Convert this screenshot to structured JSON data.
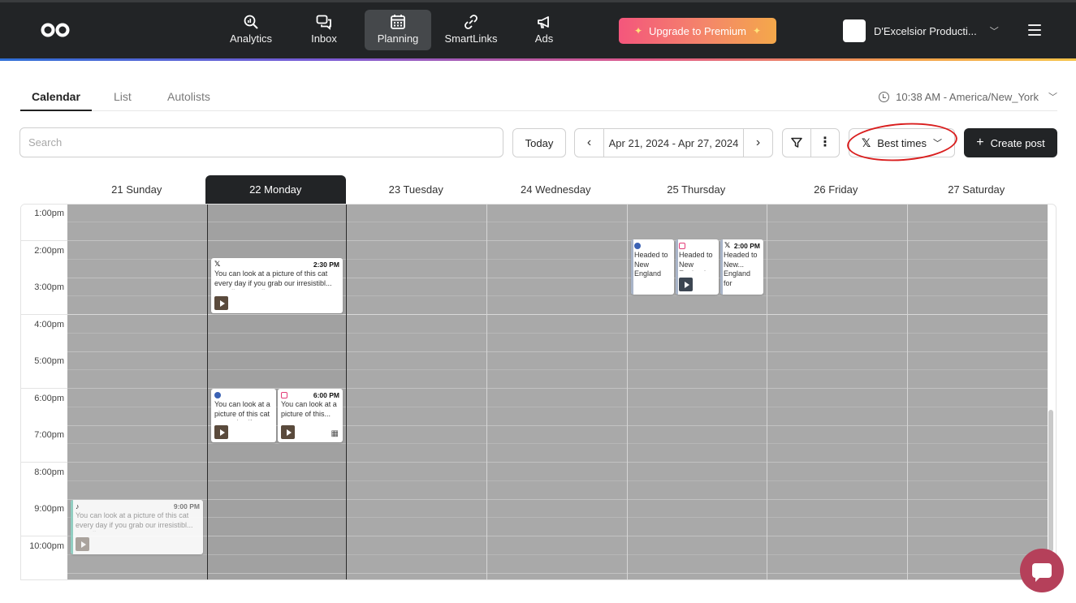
{
  "nav": {
    "items": [
      {
        "label": "Analytics",
        "icon": "analytics-icon"
      },
      {
        "label": "Inbox",
        "icon": "inbox-icon"
      },
      {
        "label": "Planning",
        "icon": "calendar-icon",
        "active": true
      },
      {
        "label": "SmartLinks",
        "icon": "link-icon"
      },
      {
        "label": "Ads",
        "icon": "megaphone-icon"
      }
    ],
    "upgrade_label": "Upgrade to Premium",
    "account_name": "D'Excelsior Producti..."
  },
  "tabs": [
    {
      "label": "Calendar",
      "active": true
    },
    {
      "label": "List"
    },
    {
      "label": "Autolists"
    }
  ],
  "timezone": "10:38 AM - America/New_York",
  "toolbar": {
    "search_placeholder": "Search",
    "today_label": "Today",
    "date_range": "Apr 21, 2024 - Apr 27, 2024",
    "best_times_label": "Best times",
    "create_post_label": "Create post"
  },
  "days": [
    {
      "label": "21 Sunday"
    },
    {
      "label": "22 Monday",
      "today": true
    },
    {
      "label": "23 Tuesday"
    },
    {
      "label": "24 Wednesday"
    },
    {
      "label": "25 Thursday"
    },
    {
      "label": "26 Friday"
    },
    {
      "label": "27 Saturday"
    }
  ],
  "time_labels": [
    "1:00pm",
    "2:00pm",
    "3:00pm",
    "4:00pm",
    "5:00pm",
    "6:00pm",
    "7:00pm",
    "8:00pm",
    "9:00pm",
    "10:00pm"
  ],
  "posts": {
    "mon_x": {
      "time": "2:30 PM",
      "text": "You can look at a picture of this cat every day if you grab our irresistibl... mug #catmug #cats",
      "network": "x"
    },
    "mon_fb": {
      "time": "",
      "text": "You can look at a picture of this cat every day if you grab our",
      "network": "facebook"
    },
    "mon_ig": {
      "time": "6:00 PM",
      "text": "You can look at a picture of this...",
      "network": "instagram"
    },
    "thu_fb": {
      "time": "",
      "text": "Headed to New England for Memorial Day Weekend",
      "network": "facebook"
    },
    "thu_ig": {
      "time": "",
      "text": "Headed to New England for Memorial Day Weekend",
      "network": "instagram"
    },
    "thu_x": {
      "time": "2:00 PM",
      "text": "Headed to New... England for",
      "network": "x"
    },
    "sun_tt": {
      "time": "9:00 PM",
      "text": "You can look at a picture of this cat every day if you grab our irresistibl... mug #catmug",
      "network": "tiktok"
    }
  },
  "colors": {
    "accent_dark": "#222426",
    "premium_start": "#f4567c",
    "premium_end": "#f4a84a",
    "highlight_ring": "#d91e1e",
    "facebook": "#3b62b4",
    "instagram": "#e33c78",
    "chat": "#b5405a"
  }
}
